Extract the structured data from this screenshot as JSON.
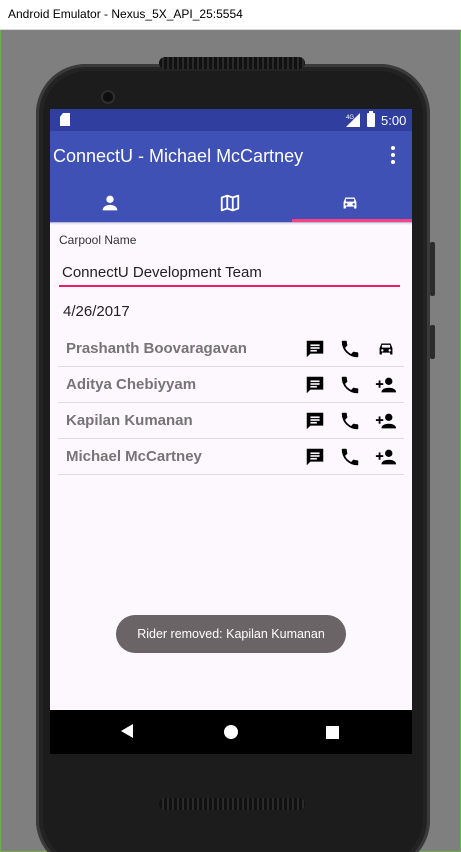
{
  "window": {
    "title": "Android Emulator - Nexus_5X_API_25:5554"
  },
  "status_bar": {
    "network": "4G",
    "time": "5:00",
    "icons": [
      "sd-card-icon",
      "signal-icon",
      "battery-icon"
    ]
  },
  "app_bar": {
    "title": "ConnectU - Michael McCartney",
    "overflow_icon": "more-vert-icon"
  },
  "tabs": [
    {
      "icon": "person-icon",
      "selected": false
    },
    {
      "icon": "map-icon",
      "selected": false
    },
    {
      "icon": "car-icon",
      "selected": true
    }
  ],
  "form": {
    "carpool_name_label": "Carpool Name",
    "carpool_name_value": "ConnectU Development Team",
    "date": "4/26/2017"
  },
  "riders": [
    {
      "name": "Prashanth Boovaragavan",
      "action_icon": "car-icon"
    },
    {
      "name": "Aditya Chebiyyam",
      "action_icon": "add-person-icon"
    },
    {
      "name": "Kapilan Kumanan",
      "action_icon": "add-person-icon"
    },
    {
      "name": "Michael McCartney",
      "action_icon": "add-person-icon"
    }
  ],
  "toast": {
    "message": "Rider removed: Kapilan Kumanan"
  },
  "colors": {
    "primary": "#3f51b5",
    "primary_dark": "#303f9f",
    "accent": "#ff4081",
    "input_underline": "#e91e63"
  }
}
